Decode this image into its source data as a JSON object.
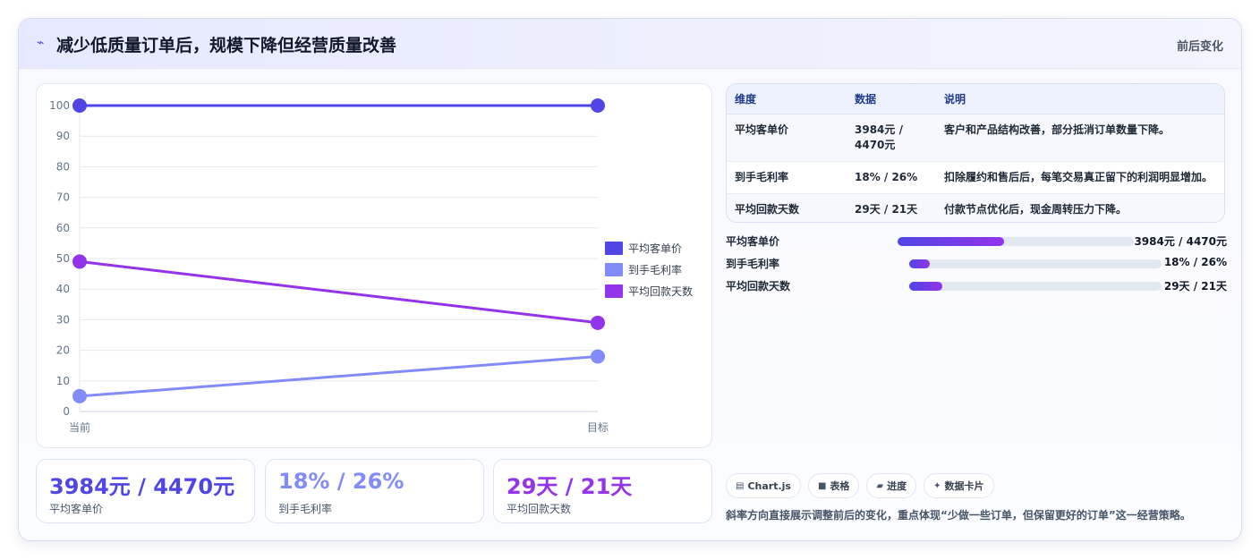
{
  "header": {
    "icon": "trend-line-icon",
    "title": "减少低质量订单后，规模下降但经营质量改善",
    "tag": "前后变化"
  },
  "chart_data": {
    "type": "line",
    "categories": [
      "当前",
      "目标"
    ],
    "series": [
      {
        "name": "平均客单价",
        "values": [
          100,
          100
        ],
        "color": "#4f46e5"
      },
      {
        "name": "到手毛利率",
        "values": [
          5,
          18
        ],
        "color": "#818cf8"
      },
      {
        "name": "平均回款天数",
        "values": [
          49,
          29
        ],
        "color": "#9333ea"
      }
    ],
    "ylim": [
      0,
      100
    ],
    "yticks": [
      0,
      10,
      20,
      30,
      40,
      50,
      60,
      70,
      80,
      90,
      100
    ],
    "grid": true,
    "legend": "right"
  },
  "stats": [
    {
      "value": "3984元 / 4470元",
      "label": "平均客单价",
      "color": "#4f46e5"
    },
    {
      "value": "18% / 26%",
      "label": "到手毛利率",
      "color": "#818cf8"
    },
    {
      "value": "29天 / 21天",
      "label": "平均回款天数",
      "color": "#9333ea"
    }
  ],
  "table": {
    "headers": [
      "维度",
      "数据",
      "说明"
    ],
    "rows": [
      {
        "dim": "平均客单价",
        "data": "3984元 / 4470元",
        "note": "客户和产品结构改善，部分抵消订单数量下降。"
      },
      {
        "dim": "到手毛利率",
        "data": "18% / 26%",
        "note": "扣除履约和售后后，每笔交易真正留下的利润明显增加。"
      },
      {
        "dim": "平均回款天数",
        "data": "29天 / 21天",
        "note": "付款节点优化后，现金周转压力下降。"
      }
    ]
  },
  "progress": [
    {
      "label": "平均客单价",
      "value": "3984元 / 4470元",
      "fill": 0.45
    },
    {
      "label": "到手毛利率",
      "value": "18% / 26%",
      "fill": 0.08
    },
    {
      "label": "平均回款天数",
      "value": "29天 / 21天",
      "fill": 0.13
    }
  ],
  "chips": [
    {
      "icon": "chart-icon",
      "glyph": "▤",
      "label": "Chart.js"
    },
    {
      "icon": "table-icon",
      "glyph": "■",
      "label": "表格"
    },
    {
      "icon": "progress-icon",
      "glyph": "▰",
      "label": "进度"
    },
    {
      "icon": "sparkle-icon",
      "glyph": "✦",
      "label": "数据卡片"
    }
  ],
  "footnote": "斜率方向直接展示调整前后的变化，重点体现“少做一些订单，但保留更好的订单”这一经营策略。"
}
